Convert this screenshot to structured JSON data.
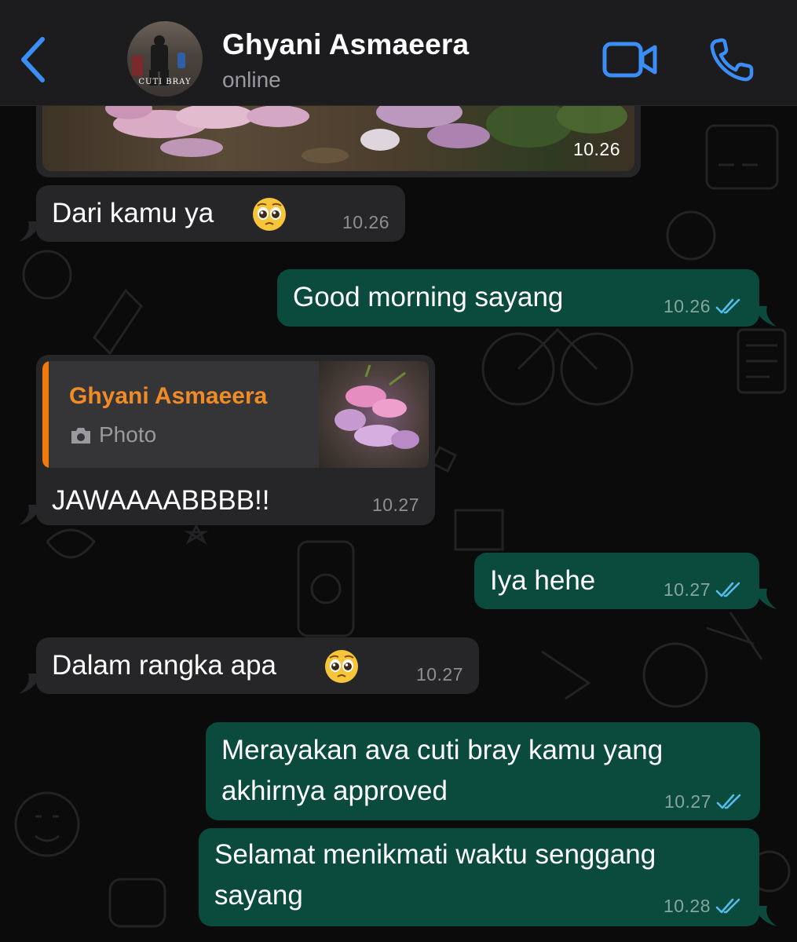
{
  "header": {
    "contact_name": "Ghyani Asmaeera",
    "status": "online",
    "avatar_caption": "CUTI BRAY",
    "back_icon": "chevron-left-icon",
    "video_icon": "video-camera-icon",
    "call_icon": "phone-icon",
    "accent_color": "#3a8ef6"
  },
  "messages": [
    {
      "type": "photo",
      "direction": "incoming",
      "time": "10.26"
    },
    {
      "type": "text",
      "direction": "incoming",
      "text": "Dari kamu ya",
      "emoji": "pleading-face",
      "time": "10.26"
    },
    {
      "type": "text",
      "direction": "outgoing",
      "text": "Good morning sayang",
      "time": "10.26",
      "read": true
    },
    {
      "type": "reply",
      "direction": "incoming",
      "quote": {
        "name": "Ghyani Asmaeera",
        "label": "Photo",
        "icon": "camera-icon"
      },
      "text": "JAWAAAABBBB!!",
      "time": "10.27"
    },
    {
      "type": "text",
      "direction": "outgoing",
      "text": "Iya hehe",
      "time": "10.27",
      "read": true
    },
    {
      "type": "text",
      "direction": "incoming",
      "text": "Dalam rangka apa",
      "emoji": "pleading-face",
      "time": "10.27"
    },
    {
      "type": "text",
      "direction": "outgoing",
      "lines": [
        "Merayakan ava cuti bray kamu yang",
        "akhirnya approved"
      ],
      "time": "10.27",
      "read": true
    },
    {
      "type": "text",
      "direction": "outgoing",
      "lines": [
        "Selamat menikmati waktu senggang",
        "sayang"
      ],
      "time": "10.28",
      "read": true
    }
  ],
  "colors": {
    "incoming_bubble": "#262628",
    "outgoing_bubble": "#0b4b3d",
    "read_ticks": "#53bdeb",
    "quote_accent": "#f07a0a"
  }
}
